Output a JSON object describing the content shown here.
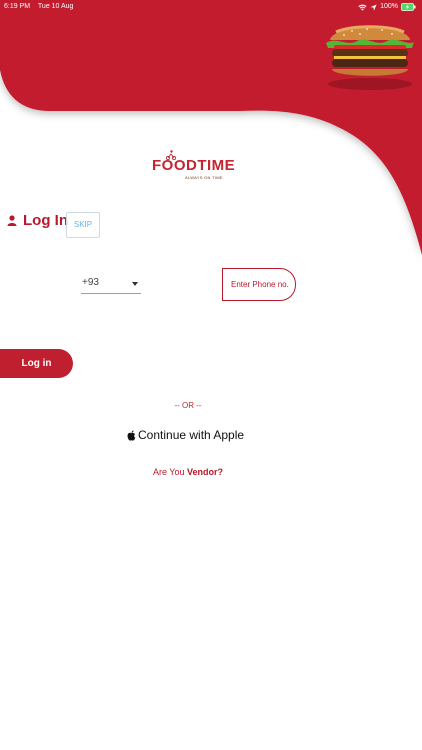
{
  "status_bar": {
    "time": "6:19 PM",
    "date": "Tue 10 Aug",
    "battery": "100%"
  },
  "brand": {
    "logo_text": "FOODTIME",
    "tagline": "ALWAYS ON TIME"
  },
  "login": {
    "title": "Log In",
    "skip_label": "SKIP",
    "country_code": "+93",
    "phone_placeholder": "Enter Phone no.",
    "submit_label": "Log in",
    "divider_text": "-- OR --",
    "apple_label": "Continue with Apple",
    "vendor_prompt": "Are You",
    "vendor_link": "Vendor?"
  },
  "colors": {
    "primary": "#c01f2f",
    "accent": "#e5a11b",
    "skip": "#69b3de"
  },
  "icons": [
    "wifi-icon",
    "location-icon",
    "battery-icon",
    "user-icon",
    "dropdown-caret-icon",
    "apple-icon",
    "burger-image"
  ]
}
